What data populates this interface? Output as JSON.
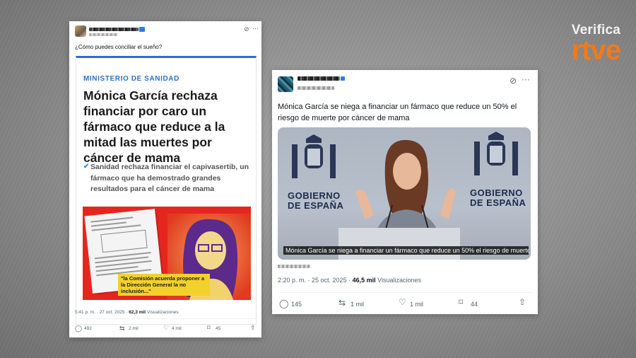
{
  "brand": {
    "verifica": "Verifica",
    "rtve": "rtve"
  },
  "left_post": {
    "text": "¿Cómo puedes conciliar el sueño?",
    "article": {
      "section": "MINISTERIO DE SANIDAD",
      "headline": "Mónica García rechaza financiar por caro un fármaco que reduce a la mitad las muertes por cáncer de mama",
      "subhead": "Sanidad rechaza financiar el capivasertib, un fármaco que ha demostrado grandes resultados para el cáncer de mama",
      "quote": "\"la Comisión acuerda proponer a la Dirección General la no inclusión...\""
    },
    "time": "5:41 p. m.",
    "date": "27 oct. 2025",
    "views": "62,3 mil",
    "views_label": "Visualizaciones",
    "replies": "492",
    "reposts": "2 mil",
    "likes": "4 mil",
    "bookmarks": "45"
  },
  "right_post": {
    "text": "Mónica García se niega a financiar un fármaco que reduce un 50% el riesgo de muerte por cáncer de mama",
    "video": {
      "gov_left": "GOBIERNO\nDE ESPAÑA",
      "gov_right": "GOBIERNO\nDE ESPAÑA",
      "caption": "Mónica García se niega a financiar un fármaco que reduce un 50% el riesgo de muerte ..."
    },
    "time": "2:20 p. m.",
    "date": "25 oct. 2025",
    "views": "46,5 mil",
    "views_label": "Visualizaciones",
    "replies": "145",
    "reposts": "1 mil",
    "likes": "1 mil",
    "bookmarks": "44"
  },
  "icons": {
    "reply": "reply-icon",
    "repost": "repost-icon",
    "like": "heart-icon",
    "bookmark": "bookmark-icon",
    "share": "share-icon",
    "more": "more-icon",
    "grok": "grok-icon"
  }
}
